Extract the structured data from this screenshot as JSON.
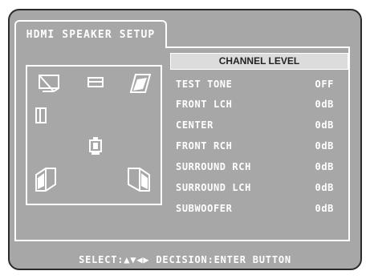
{
  "title": "HDMI SPEAKER SETUP",
  "panel": {
    "header": "CHANNEL LEVEL",
    "rows": [
      {
        "label": "TEST TONE",
        "value": "OFF"
      },
      {
        "label": "FRONT LCH",
        "value": "0dB"
      },
      {
        "label": "CENTER",
        "value": "0dB"
      },
      {
        "label": "FRONT RCH",
        "value": "0dB"
      },
      {
        "label": "SURROUND RCH",
        "value": "0dB"
      },
      {
        "label": "SURROUND LCH",
        "value": "0dB"
      },
      {
        "label": "SUBWOOFER",
        "value": "0dB"
      }
    ]
  },
  "footer": "SELECT:▲▼◀▶ DECISION:ENTER BUTTON",
  "icons": [
    "front-left-speaker-icon",
    "center-speaker-icon",
    "front-right-speaker-icon",
    "side-speaker-icon",
    "listener-icon",
    "surround-left-speaker-icon",
    "surround-right-speaker-icon"
  ],
  "colors": {
    "background": "#a7a7a7",
    "text": "#ffffff",
    "header_bg": "#dcdcdc",
    "header_text": "#222222"
  }
}
